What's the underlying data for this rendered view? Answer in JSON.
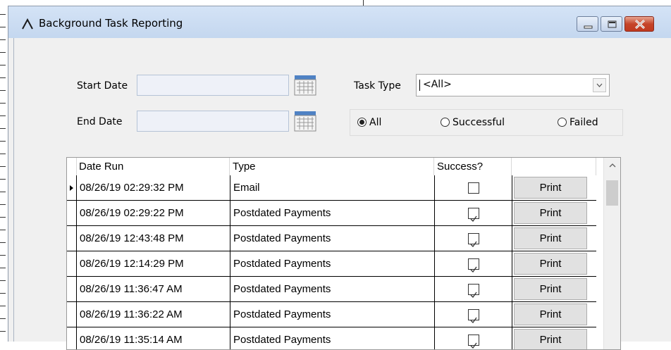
{
  "window": {
    "title": "Background Task Reporting",
    "controls": {
      "minimize": "minimize",
      "maximize": "maximize",
      "close": "close"
    }
  },
  "filters": {
    "start_date_label": "Start Date",
    "start_date_value": "",
    "end_date_label": "End Date",
    "end_date_value": "",
    "task_type_label": "Task Type",
    "task_type_value": "<All>",
    "status_options": [
      {
        "label": "All",
        "selected": true
      },
      {
        "label": "Successful",
        "selected": false
      },
      {
        "label": "Failed",
        "selected": false
      }
    ]
  },
  "grid": {
    "columns": [
      "Date Run",
      "Type",
      "Success?",
      ""
    ],
    "print_label": "Print",
    "rows": [
      {
        "date_run": "08/26/19 02:29:32 PM",
        "type": "Email",
        "success": false,
        "current": true
      },
      {
        "date_run": "08/26/19 02:29:22 PM",
        "type": "Postdated Payments",
        "success": true
      },
      {
        "date_run": "08/26/19 12:43:48 PM",
        "type": "Postdated Payments",
        "success": true
      },
      {
        "date_run": "08/26/19 12:14:29 PM",
        "type": "Postdated Payments",
        "success": true
      },
      {
        "date_run": "08/26/19 11:36:47 AM",
        "type": "Postdated Payments",
        "success": true
      },
      {
        "date_run": "08/26/19 11:36:22 AM",
        "type": "Postdated Payments",
        "success": true
      },
      {
        "date_run": "08/26/19 11:35:14 AM",
        "type": "Postdated Payments",
        "success": true
      }
    ]
  },
  "colors": {
    "title_bar": "#c9dbf2",
    "window_bg": "#f0f0f0",
    "close_button": "#c9462c"
  }
}
